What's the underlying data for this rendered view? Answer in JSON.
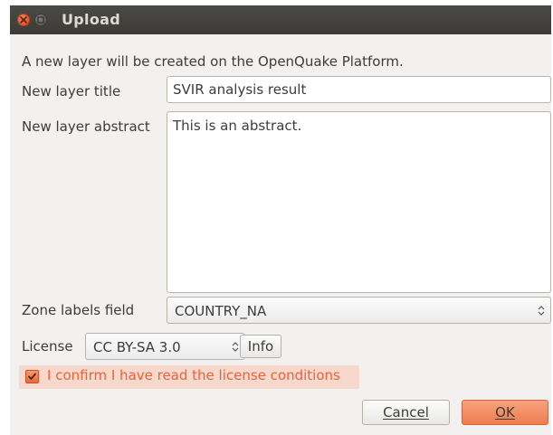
{
  "window": {
    "title": "Upload"
  },
  "info_text": "A new layer will be created on the OpenQuake Platform.",
  "fields": {
    "title_label": "New layer title",
    "title_value": "SVIR analysis result",
    "abstract_label": "New layer abstract",
    "abstract_value": "This is an abstract.",
    "zone_label": "Zone labels field",
    "zone_value": "COUNTRY_NA",
    "license_label": "License",
    "license_value": "CC BY-SA 3.0",
    "info_button": "Info"
  },
  "confirm": {
    "label": "I confirm I have read the license conditions",
    "checked": true
  },
  "buttons": {
    "cancel": "Cancel",
    "ok": "OK"
  },
  "colors": {
    "accent": "#ef7d4f",
    "titlebar": "#3c3b37",
    "background": "#f2f1f0"
  }
}
